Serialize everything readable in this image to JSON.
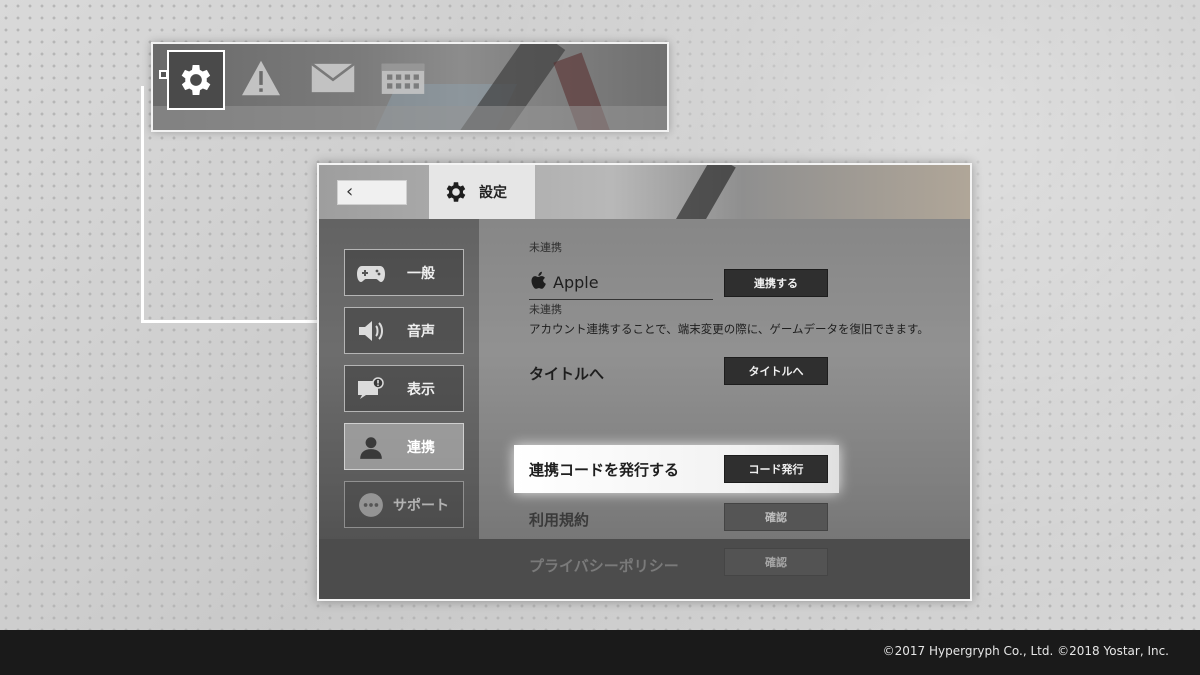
{
  "toolbar": {
    "icons": [
      "gear-icon",
      "alert-icon",
      "mail-icon",
      "calendar-icon"
    ]
  },
  "window": {
    "back_label": "‹",
    "tab_label": "設定"
  },
  "sidebar": {
    "items": [
      {
        "label": "一般",
        "icon": "gamepad-icon"
      },
      {
        "label": "音声",
        "icon": "speaker-icon"
      },
      {
        "label": "表示",
        "icon": "display-icon"
      },
      {
        "label": "連携",
        "icon": "user-icon"
      },
      {
        "label": "サポート",
        "icon": "more-icon"
      }
    ],
    "active_index": 3
  },
  "content": {
    "prev_status": "未連携",
    "apple": {
      "label": "Apple",
      "status": "未連携",
      "button": "連携する"
    },
    "note": "アカウント連携することで、端末変更の際に、ゲームデータを復旧できます。",
    "title_row": {
      "label": "タイトルへ",
      "button": "タイトルへ"
    },
    "code_row": {
      "label": "連携コードを発行する",
      "button": "コード発行"
    },
    "terms_row": {
      "label": "利用規約",
      "button": "確認"
    },
    "privacy_row": {
      "label": "プライバシーポリシー",
      "button": "確認"
    }
  },
  "footer": {
    "copyright": "©2017 Hypergryph Co., Ltd. ©2018 Yostar, Inc."
  },
  "colors": {
    "accent": "#ffffff",
    "button_dark": "#2f2f2f",
    "footer_bg": "#1a1a1a"
  }
}
